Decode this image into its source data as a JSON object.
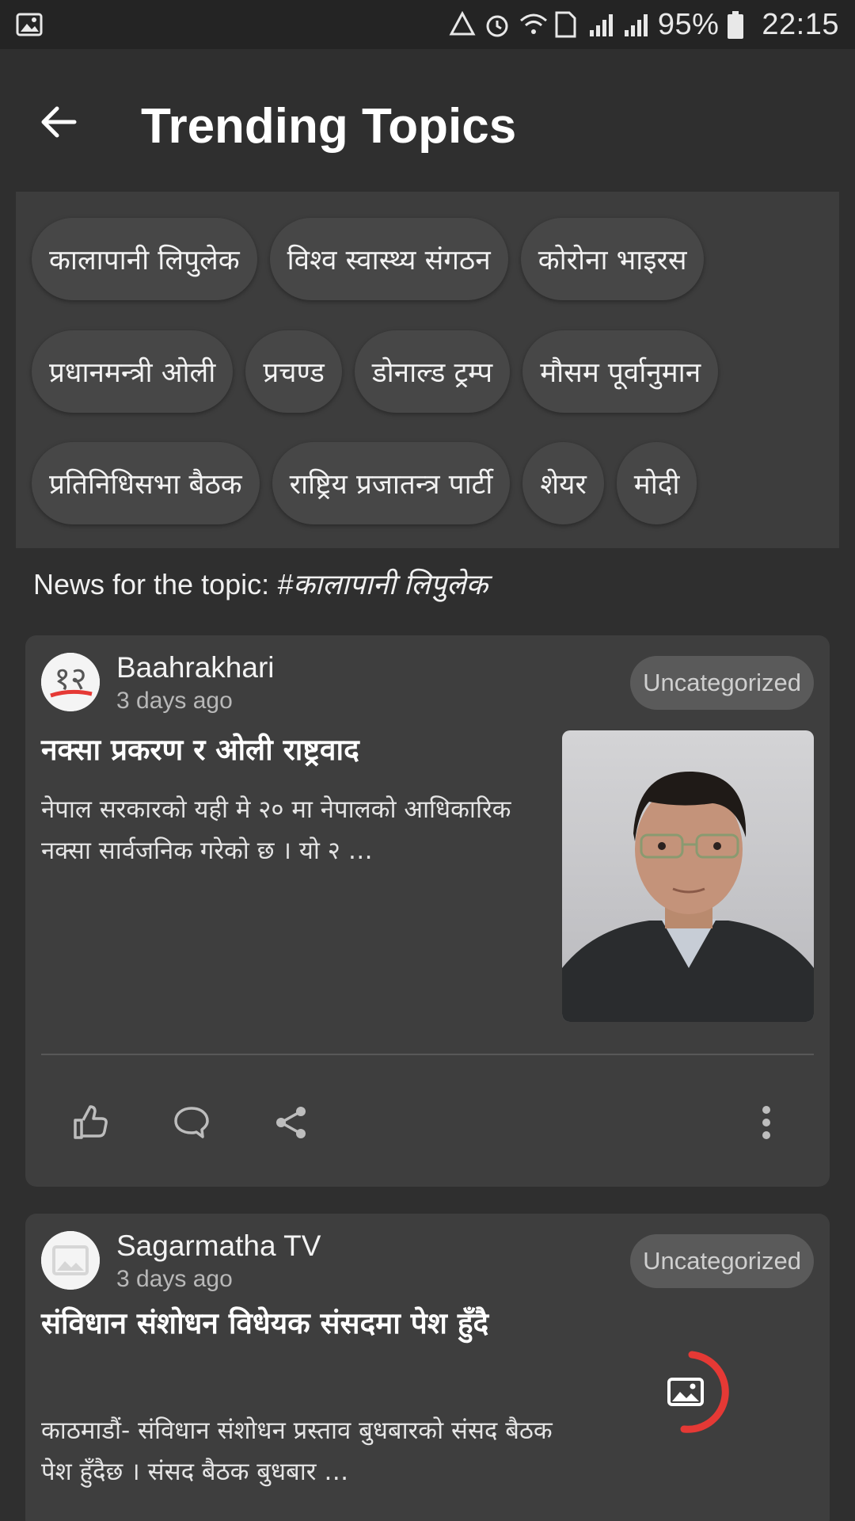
{
  "status_bar": {
    "battery": "95%",
    "time": "22:15"
  },
  "header": {
    "title": "Trending Topics"
  },
  "chips": [
    [
      "कालापानी लिपुलेक",
      "विश्व स्वास्थ्य संगठन",
      "कोरोना भाइरस"
    ],
    [
      "प्रधानमन्त्री ओली",
      "प्रचण्ड",
      "डोनाल्ड ट्रम्प",
      "मौसम पूर्वानुमान"
    ],
    [
      "प्रतिनिधिसभा बैठक",
      "राष्ट्रिय प्रजातन्त्र पार्टी",
      "शेयर",
      "मोदी"
    ]
  ],
  "topic": {
    "prefix": "News for the topic: ",
    "tag": "#कालापानी लिपुलेक"
  },
  "cards": [
    {
      "source": "Baahrakhari",
      "time": "3 days ago",
      "category": "Uncategorized",
      "headline": "नक्सा प्रकरण र ओली राष्ट्रवाद",
      "excerpt": "नेपाल सरकारको यही मे २० मा नेपालको आधिकारिक नक्सा सार्वजनिक गरेको छ । यो २ …"
    },
    {
      "source": "Sagarmatha TV",
      "time": "3 days ago",
      "category": "Uncategorized",
      "headline": "संविधान संशोधन विधेयक संसदमा पेश हुँदै",
      "excerpt": "काठमाडौं- संविधान संशोधन प्रस्ताव बुधबारको संसद बैठक पेश हुँदैछ । संसद बैठक बुधबार …"
    }
  ],
  "colors": {
    "background": "#2f2f2f",
    "panel": "#3d3d3d",
    "card": "#3e3e3e",
    "loader_accent": "#e53935"
  }
}
